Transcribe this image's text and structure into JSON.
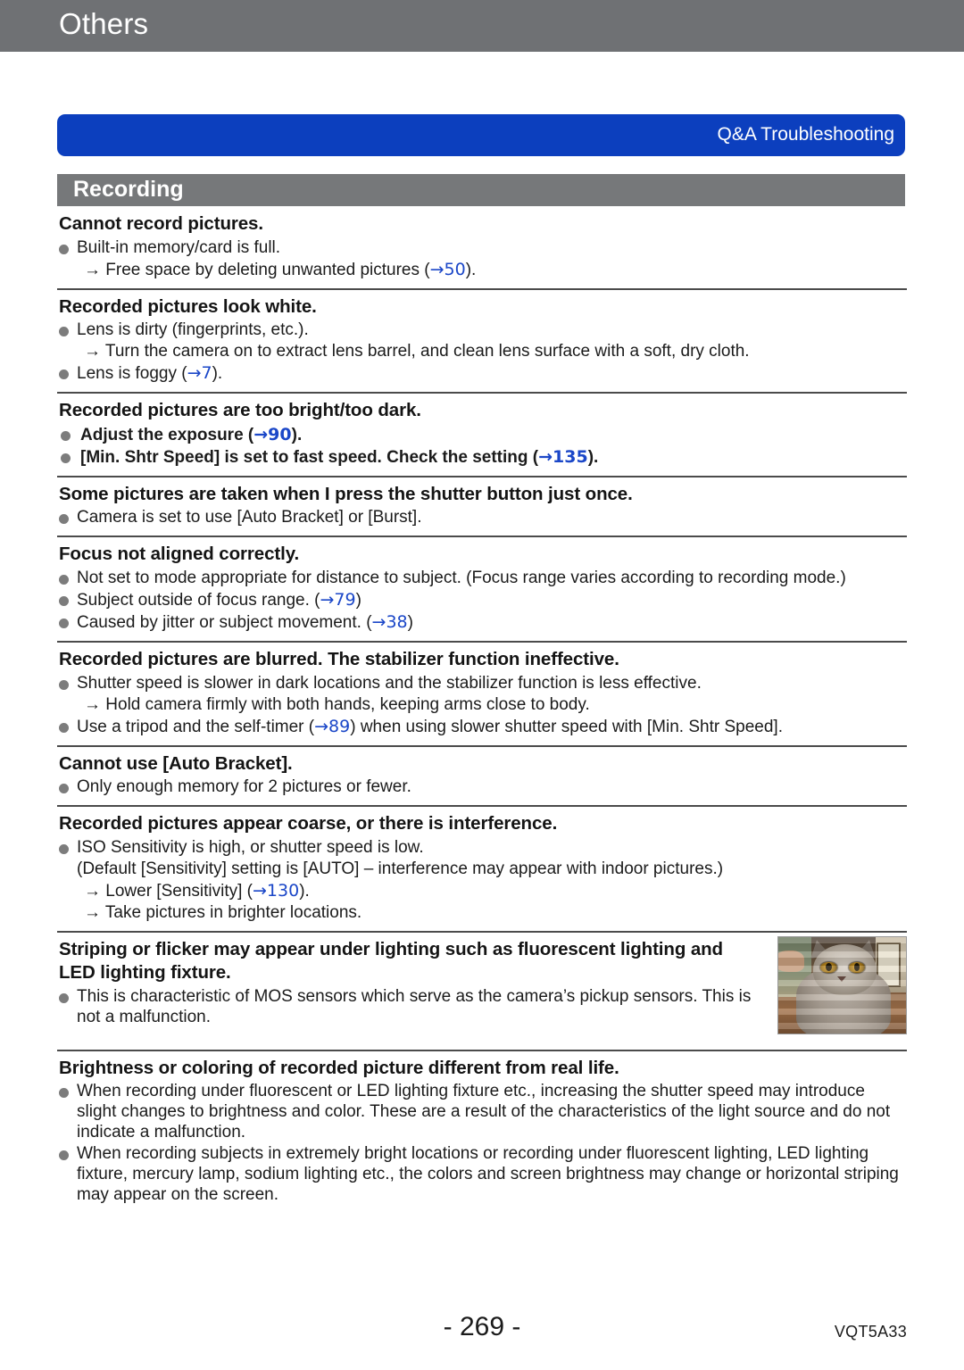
{
  "chapter": {
    "title": "Others"
  },
  "banner": {
    "label": "Q&A  Troubleshooting"
  },
  "section": {
    "label": "Recording"
  },
  "blocks": [
    {
      "heading": "Cannot record pictures.",
      "items": [
        {
          "kind": "bullet",
          "text": "Built-in memory/card is full."
        },
        {
          "kind": "arrow",
          "pre": "→ Free space by deleting unwanted pictures (",
          "ref": "→50",
          "post": ")."
        }
      ]
    },
    {
      "heading": "Recorded pictures look white.",
      "items": [
        {
          "kind": "bullet",
          "text": "Lens is dirty (fingerprints, etc.)."
        },
        {
          "kind": "arrow",
          "pre": "→ Turn the camera on to extract lens barrel, and clean lens surface with a soft, dry cloth.",
          "ref": "",
          "post": ""
        },
        {
          "kind": "bullet",
          "pre": "Lens is foggy (",
          "ref": "→7",
          "post": ")."
        }
      ]
    },
    {
      "heading": "Recorded pictures are too bright/too dark.",
      "items": [
        {
          "kind": "bullet-bold",
          "pre": "Adjust the exposure (",
          "ref": "→90",
          "post": ")."
        },
        {
          "kind": "bullet-bold",
          "pre": "[Min. Shtr Speed] is set to fast speed. Check the setting (",
          "ref": "→135",
          "post": ")."
        }
      ]
    },
    {
      "heading": "Some pictures are taken when I press the shutter button just once.",
      "items": [
        {
          "kind": "bullet",
          "text": "Camera is set to use [Auto Bracket] or [Burst]."
        }
      ]
    },
    {
      "heading": "Focus not aligned correctly.",
      "items": [
        {
          "kind": "bullet",
          "text": "Not set to mode appropriate for distance to subject. (Focus range varies according to recording mode.)"
        },
        {
          "kind": "bullet",
          "pre": "Subject outside of focus range. (",
          "ref": "→79",
          "post": ")"
        },
        {
          "kind": "bullet",
          "pre": "Caused by jitter or subject movement. (",
          "ref": "→38",
          "post": ")"
        }
      ]
    },
    {
      "heading": "Recorded pictures are blurred. The stabilizer function ineffective.",
      "items": [
        {
          "kind": "bullet",
          "text": "Shutter speed is slower in dark locations and the stabilizer function is less effective."
        },
        {
          "kind": "arrow",
          "pre": "→ Hold camera firmly with both hands, keeping arms close to body.",
          "ref": "",
          "post": ""
        },
        {
          "kind": "bullet",
          "pre": "Use a tripod and the self-timer (",
          "ref": "→89",
          "post": ") when using slower shutter speed with [Min. Shtr Speed]."
        }
      ]
    },
    {
      "heading": "Cannot use [Auto Bracket].",
      "items": [
        {
          "kind": "bullet",
          "text": "Only enough memory for 2 pictures or fewer."
        }
      ]
    },
    {
      "heading": "Recorded pictures appear coarse, or there is interference.",
      "items": [
        {
          "kind": "bullet",
          "text": "ISO Sensitivity is high, or shutter speed is low."
        },
        {
          "kind": "cont",
          "text": "(Default [Sensitivity] setting is [AUTO] – interference may appear with indoor pictures.)"
        },
        {
          "kind": "arrow",
          "pre": "→ Lower [Sensitivity] (",
          "ref": "→130",
          "post": ")."
        },
        {
          "kind": "arrow",
          "pre": "→ Take pictures in brighter locations.",
          "ref": "",
          "post": ""
        }
      ]
    },
    {
      "heading": "Striping or flicker may appear under lighting such as fluorescent lighting and LED lighting fixture.",
      "has_photo": true,
      "photo_name": "striping-sample-photo",
      "items": [
        {
          "kind": "bullet",
          "text": "This is characteristic of MOS sensors which serve as the camera’s pickup sensors. This is not a malfunction."
        }
      ]
    },
    {
      "heading": "Brightness or coloring of recorded picture different from real life.",
      "last": true,
      "items": [
        {
          "kind": "bullet",
          "text": "When recording under fluorescent or LED lighting fixture etc., increasing the shutter speed may introduce slight changes to brightness and color. These are a result of the characteristics of the light source and do not indicate a malfunction."
        },
        {
          "kind": "bullet",
          "text": "When recording subjects in extremely bright locations or recording under fluorescent lighting, LED lighting fixture, mercury lamp, sodium lighting etc., the colors and screen brightness may change or horizontal striping may appear on the screen."
        }
      ]
    }
  ],
  "footer": {
    "page_number": "- 269 -",
    "doc_code": "VQT5A33"
  }
}
